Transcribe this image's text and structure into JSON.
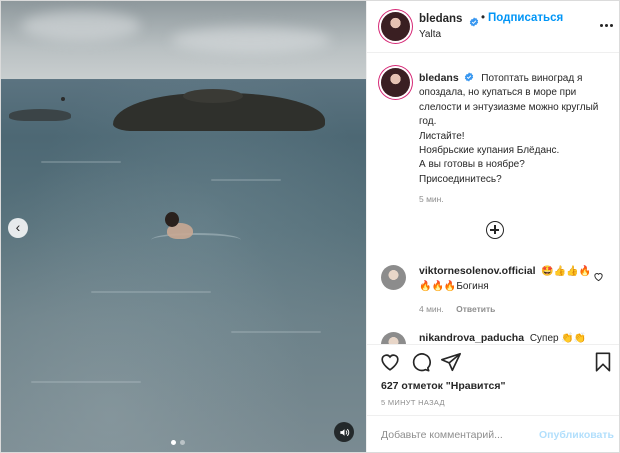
{
  "post": {
    "author": {
      "username": "bledans",
      "verified": true,
      "follow_separator": "•",
      "follow_label": "Подписаться",
      "location": "Yalta"
    },
    "media": {
      "carousel_total": 2,
      "carousel_index": 0,
      "icons": {
        "prev": "chevron-left-icon",
        "sound": "speaker-icon"
      }
    },
    "caption": {
      "username": "bledans",
      "text": "Потоптать виноград я опоздала, но купаться в море при слелости и энтузиазме можно круглый год.\nЛистайте!\nНоябрьские купания Блёданс.\nА вы готовы в ноябре?\nПрисоединитесь?",
      "time": "5 мин."
    },
    "comments": [
      {
        "username": "viktornesolenov.official",
        "text": "🤩👍👍🔥🔥🔥🔥Богиня",
        "time": "4 мин.",
        "reply_label": "Ответить"
      },
      {
        "username": "nikandrova_paducha",
        "text": "Супер 👏👏"
      }
    ],
    "actions": {
      "icons": [
        "heart-icon",
        "comment-icon",
        "share-icon",
        "bookmark-icon"
      ]
    },
    "likes_text": "627 отметок \"Нравится\"",
    "time_ago": "5 МИНУТ НАЗАД",
    "comment_placeholder": "Добавьте комментарий...",
    "post_button": "Опубликовать",
    "colors": {
      "accent": "#0095f6",
      "ring": "#d62976",
      "muted": "#8e8e8e",
      "text": "#262626"
    }
  }
}
